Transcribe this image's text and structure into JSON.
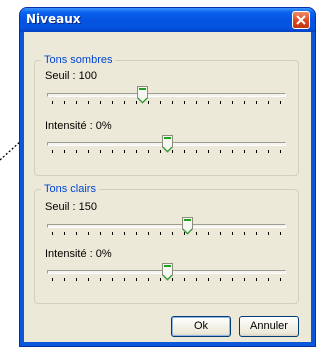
{
  "window": {
    "title": "Niveaux"
  },
  "shadows": {
    "group_label": "Tons sombres",
    "threshold_label": "Seuil : 100",
    "threshold_value": 100,
    "intensity_label": "Intensité : 0%",
    "intensity_value": 0
  },
  "highlights": {
    "group_label": "Tons clairs",
    "threshold_label": "Seuil : 150",
    "threshold_value": 150,
    "intensity_label": "Intensité : 0%",
    "intensity_value": 0
  },
  "buttons": {
    "ok": "Ok",
    "cancel": "Annuler"
  },
  "icons": {
    "close": "close-icon",
    "arrow": "arrow-annotation"
  },
  "colors": {
    "title_bar": "#0553e1",
    "group_label": "#0046d5",
    "close_button": "#d8431e",
    "dialog_bg": "#ece9d8"
  }
}
